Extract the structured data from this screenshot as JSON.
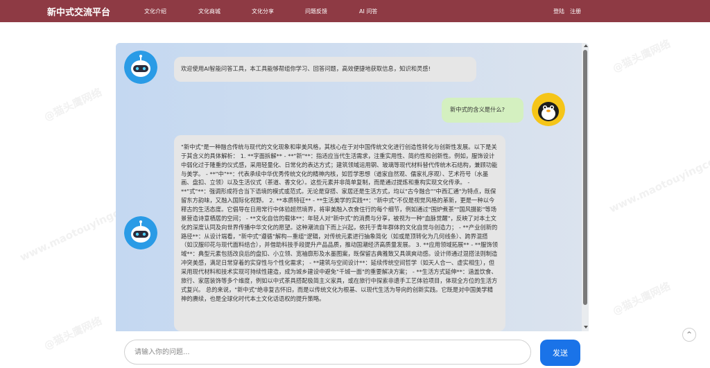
{
  "header": {
    "brand": "新中式交流平台",
    "nav": [
      {
        "label": "文化介绍"
      },
      {
        "label": "文化商城"
      },
      {
        "label": "文化分享"
      },
      {
        "label": "问题反馈"
      },
      {
        "label": "AI 问答"
      }
    ],
    "login": "登陆",
    "register": "注册"
  },
  "chat": {
    "messages": [
      {
        "role": "bot",
        "text": "欢迎使用AI智能问答工具，本工具能够帮组你学习、回答问题，高效便捷地获取信息，知识和灵感!"
      },
      {
        "role": "user",
        "text": "新中式的含义是什么?"
      },
      {
        "role": "bot",
        "text": "\"新中式\"是一种融合传统与现代的文化现象和审美风格，其核心在于对中国传统文化进行创造性转化与创新性发展。以下是关于其含义的具体解析： 1. **字面拆解** - **\"新\"**：指适应当代生活需求，注重实用性、简约性和创新性。例如，服饰设计中弱化过于隆重的仪式感，采用轻量化、日常化的表达方式；建筑领域运用钢、玻璃等现代材料替代传统木石结构，兼顾功能与美学。 - **\"中\"**：代表承续中华优秀传统文化的精神内核，如哲学思想（道家自然观、儒家礼序观）、艺术符号（水墨画、盘扣、立领）以及生活仪式（茶道、香文化）。这些元素并非简单复制，而是通过提炼和重构实现文化传承。 - **\"式\"**：强调形成符合当下语境的模式或范式。无论是穿搭、家居还是生活方式，均以\"古今融合\"\"中西汇通\"为特点，既保留东方韵味，又融入国际化视野。 2. **本质特征** - **生活美学的实践**：\"新中式\"不仅是视觉风格的革新，更是一种以今释古的生活态度。它倡导在日用常行中体验超然境界，将审美融入衣食住行的每个细节，例如通过\"围炉煮茶\"\"国风摄影\"等场景营造诗意栖居的空间； - **文化自信的载体**：年轻人对\"新中式\"的消费与分享，被视为一种\"血脉觉醒\"，反映了对本土文化的深度认同及向世界传播中华文化的愿望。这种潮流自下而上兴起，依托于青年群体的文化自觉与创造力； - **产业创新的路径**：从设计端看，\"新中式\"遵循\"解构—重组\"逻辑，对传统元素进行抽象简化（如或是顶转化为几何线条）、跨界混搭（如汉服印花与现代面料结合），并借助科技手段提升产品品质，推动国潮经济高质量发展。 3. **应用领域拓展** - **服饰领域**：典型元素包括改良后的盘扣、小立领、宽袖廓形及水墨图案，既保留古典雅致又具飒爽动感。设计师通过混搭法则制造冲突美感，满足日常穿着的实穿性与个性化需求； - **建筑与空间设计**：延续传统空间哲学（如天人合一、虚实相生），但采用现代材料和技术实现可持续性建造，成为城乡建设中避免\"千城一面\"的重要解决方案； - **生活方式延伸**：涵盖饮食、旅行、家居装饰等多个维度，例如以中式茶具搭配极简主义家具，或在旅行中探索非遗手工艺体验项目，体现全方位的生活方式复兴。 总的来说，\"新中式\"绝非复古怀旧，而是以传统文化为根基、以现代生活为导向的创新实践。它既是对中国美学精神的赓续，也是全球化时代本土文化话语权的提升策略。"
      }
    ],
    "input_placeholder": "请输入你的问题...",
    "send_label": "发送"
  },
  "back_to_top": "^",
  "watermarks": [
    "@猫头鹰网络",
    "www.maotouyingcc.com"
  ],
  "colors": {
    "nav_bg": "#8e3a44",
    "send_btn": "#1a73e8",
    "bot_bubble": "#e6e6e6",
    "user_bubble": "#d4f0c0",
    "user_avatar_bg": "#f5c518"
  },
  "icons": {
    "bot_avatar": "robot-avatar-icon",
    "user_avatar": "penguin-avatar-icon",
    "back_to_top": "chevron-up-icon"
  }
}
